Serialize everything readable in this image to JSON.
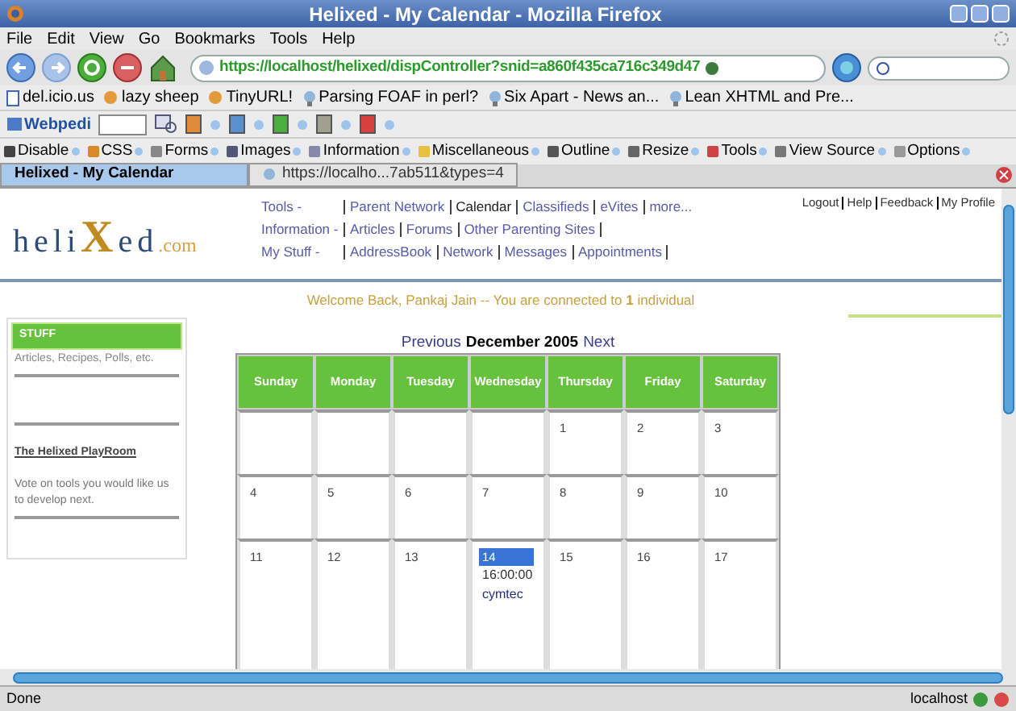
{
  "window": {
    "title": "Helixed - My Calendar - Mozilla Firefox"
  },
  "menu": [
    "File",
    "Edit",
    "View",
    "Go",
    "Bookmarks",
    "Tools",
    "Help"
  ],
  "address_bar": {
    "value": "https://localhost/helixed/dispController?snid=a860f435ca716c349d47"
  },
  "bookmarks": [
    {
      "label": "del.icio.us",
      "kind": "page"
    },
    {
      "label": "lazy sheep",
      "kind": "script"
    },
    {
      "label": "TinyURL!",
      "kind": "script"
    },
    {
      "label": "Parsing FOAF in perl?",
      "kind": "live"
    },
    {
      "label": "Six Apart - News an...",
      "kind": "live"
    },
    {
      "label": "Lean XHTML and Pre...",
      "kind": "live"
    }
  ],
  "webpedia_toolbar": {
    "label": "Webpedi"
  },
  "developer_toolbar": [
    "Disable",
    "CSS",
    "Forms",
    "Images",
    "Information",
    "Miscellaneous",
    "Outline",
    "Resize",
    "Tools",
    "View Source",
    "Options"
  ],
  "tabs": [
    {
      "label": "Helixed - My Calendar",
      "selected": true
    },
    {
      "label": "https://localho...7ab511&types=4",
      "selected": false
    }
  ],
  "site": {
    "logo": {
      "text": "heli",
      "mark": "X",
      "text2": "ed",
      "suffix": ".com"
    },
    "nav": [
      {
        "label": "Tools -",
        "links": [
          {
            "label": "Parent Network",
            "selected": false
          },
          {
            "label": "Calendar",
            "selected": true
          },
          {
            "label": "Classifieds",
            "selected": false
          },
          {
            "label": "eVites",
            "selected": false
          },
          {
            "label": "more...",
            "selected": false
          }
        ],
        "trailing_divider": false
      },
      {
        "label": "Information -",
        "links": [
          {
            "label": "Articles",
            "selected": false
          },
          {
            "label": "Forums",
            "selected": false
          },
          {
            "label": "Other Parenting Sites",
            "selected": false
          }
        ],
        "trailing_divider": true
      },
      {
        "label": "My Stuff -",
        "links": [
          {
            "label": "AddressBook",
            "selected": false
          },
          {
            "label": "Network",
            "selected": false
          },
          {
            "label": "Messages",
            "selected": false
          },
          {
            "label": "Appointments",
            "selected": false
          }
        ],
        "trailing_divider": true
      }
    ],
    "account_links": [
      "Logout",
      "Help",
      "Feedback",
      "My Profile"
    ],
    "welcome": "Welcome Back, Pankaj Jain -- You are connected to **1** individual"
  },
  "sidebar": {
    "header": "STUFF",
    "subtitle": "Articles, Recipes, Polls, etc.",
    "playroom_link": "The Helixed PlayRoom",
    "playroom_text": "Vote on tools you would like us to develop next."
  },
  "calendar": {
    "previous": "Previous",
    "title": "December 2005",
    "next": "Next",
    "columns": [
      "Sunday",
      "Monday",
      "Tuesday",
      "Wednesday",
      "Thursday",
      "Friday",
      "Saturday"
    ],
    "weeks": [
      [
        {
          "selected": false
        },
        {
          "selected": false
        },
        {
          "selected": false
        },
        {
          "selected": false
        },
        {
          "day": "1",
          "selected": false
        },
        {
          "day": "2",
          "selected": false
        },
        {
          "day": "3",
          "selected": false
        }
      ],
      [
        {
          "day": "4",
          "selected": false
        },
        {
          "day": "5",
          "selected": false
        },
        {
          "day": "6",
          "selected": false
        },
        {
          "day": "7",
          "selected": false
        },
        {
          "day": "8",
          "selected": false
        },
        {
          "day": "9",
          "selected": false
        },
        {
          "day": "10",
          "selected": false
        }
      ],
      [
        {
          "day": "11",
          "selected": false
        },
        {
          "day": "12",
          "selected": false
        },
        {
          "day": "13",
          "selected": false
        },
        {
          "day": "14",
          "selected": true,
          "events": [
            {
              "time": "16:00:00",
              "title": "cymtec"
            }
          ]
        },
        {
          "day": "15",
          "selected": false
        },
        {
          "day": "16",
          "selected": false
        },
        {
          "day": "17",
          "selected": false
        }
      ]
    ]
  },
  "status_bar": {
    "text": "Done",
    "host": "localhost"
  }
}
